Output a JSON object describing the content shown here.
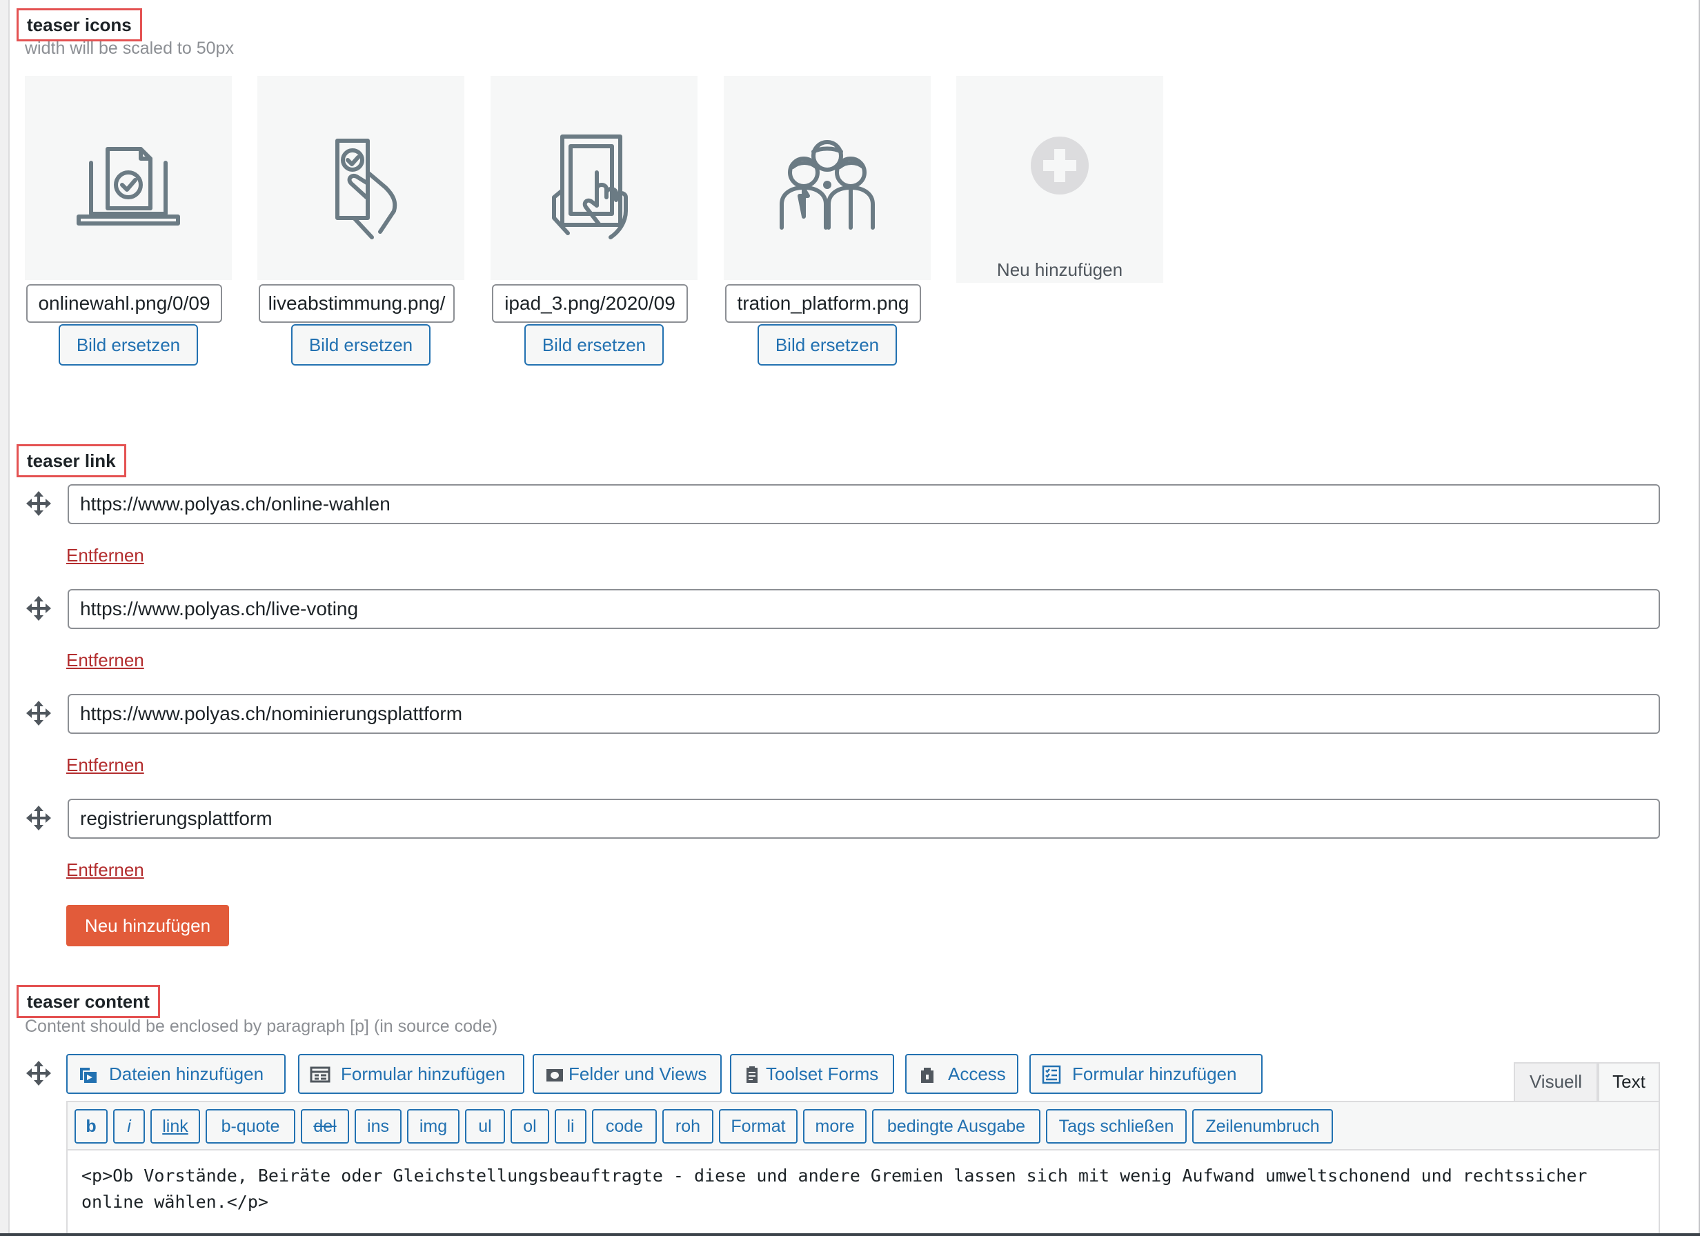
{
  "teaser_icons": {
    "label": "teaser icons",
    "description": "width will be scaled to 50px",
    "items": [
      {
        "filename": "0/09/onlinewahl.png",
        "icon": "laptop-ballot-icon",
        "button": "Bild ersetzen"
      },
      {
        "filename": "/liveabstimmung.png",
        "icon": "hand-phone-vote-icon",
        "button": "Bild ersetzen"
      },
      {
        "filename": "2020/09/ipad_3.png",
        "icon": "tablet-touch-icon",
        "button": "Bild ersetzen"
      },
      {
        "filename": "tration_platform.png",
        "icon": "group-people-icon",
        "button": "Bild ersetzen"
      }
    ],
    "add_label": "Neu hinzufügen"
  },
  "teaser_link": {
    "label": "teaser link",
    "items": [
      {
        "url": "https://www.polyas.ch/online-wahlen",
        "remove": "Entfernen"
      },
      {
        "url": "https://www.polyas.ch/live-voting",
        "remove": "Entfernen"
      },
      {
        "url": "https://www.polyas.ch/nominierungsplattform",
        "remove": "Entfernen"
      },
      {
        "url": "registrierungsplattform",
        "remove": "Entfernen"
      }
    ],
    "add_button": "Neu hinzufügen"
  },
  "teaser_content": {
    "label": "teaser content",
    "description": "Content should be enclosed by paragraph [p] (in source code)",
    "media_buttons": [
      {
        "label": "Dateien hinzufügen",
        "icon": "media-icon"
      },
      {
        "label": "Formular hinzufügen",
        "icon": "form-icon"
      },
      {
        "label": "Felder und Views",
        "icon": "fields-views-icon"
      },
      {
        "label": "Toolset Forms",
        "icon": "toolset-forms-icon"
      },
      {
        "label": "Access",
        "icon": "access-icon"
      },
      {
        "label": "Formular hinzufügen",
        "icon": "checklist-form-icon"
      }
    ],
    "tabs": {
      "visual": "Visuell",
      "text": "Text"
    },
    "quicktags": [
      "b",
      "i",
      "link",
      "b-quote",
      "del",
      "ins",
      "img",
      "ul",
      "ol",
      "li",
      "code",
      "roh",
      "Format",
      "more",
      "bedingte Ausgabe",
      "Tags schließen",
      "Zeilenumbruch"
    ],
    "editor_text": "<p>Ob Vorstände, Beiräte oder Gleichstellungsbeauftragte - diese und andere Gremien lassen sich mit wenig Aufwand umweltschonend und rechtssicher online wählen.</p>"
  }
}
